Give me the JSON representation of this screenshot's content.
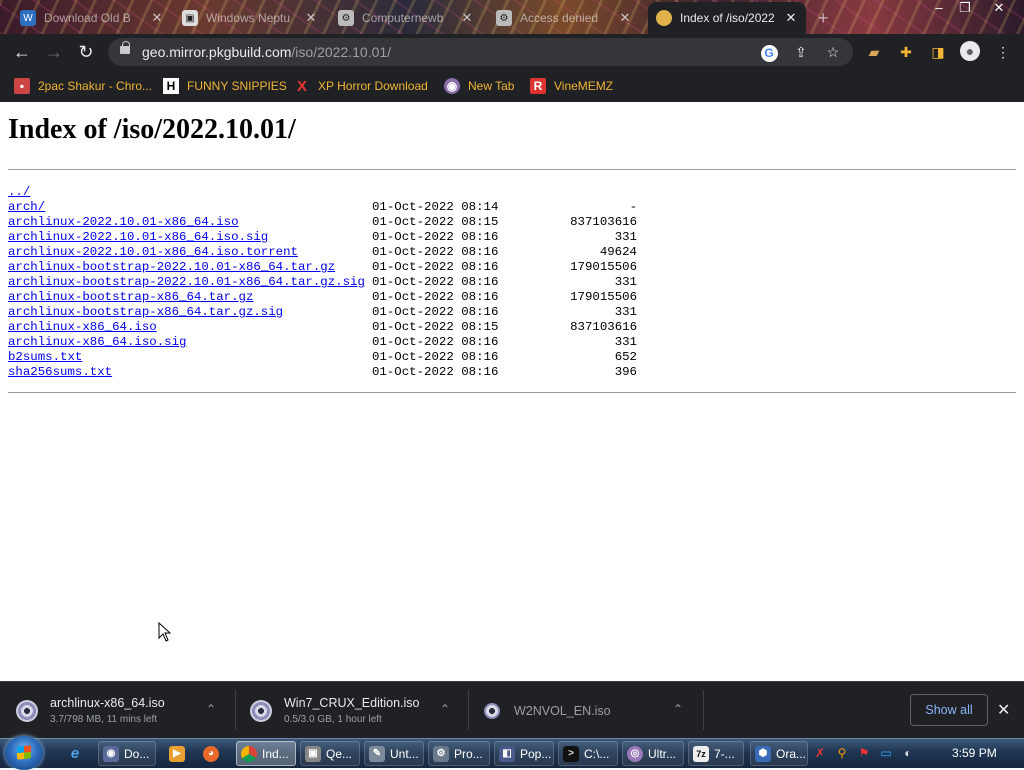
{
  "browser": {
    "tabs": [
      {
        "title": "Download Old B",
        "active": false
      },
      {
        "title": "Windows Neptu",
        "active": false
      },
      {
        "title": "Computernewb",
        "active": false
      },
      {
        "title": "Access denied",
        "active": false
      },
      {
        "title": "Index of /iso/2022",
        "active": true
      }
    ],
    "url_host": "geo.mirror.pkgbuild.com",
    "url_path": "/iso/2022.10.01/",
    "bookmarks": [
      {
        "label": "2pac Shakur - Chro...",
        "icon": "tupac-favicon"
      },
      {
        "label": "FUNNY SNIPPIES",
        "icon": "h-favicon"
      },
      {
        "label": "XP Horror Download",
        "icon": "red-x-favicon"
      },
      {
        "label": "New Tab",
        "icon": "globe-favicon"
      },
      {
        "label": "VineMEMZ",
        "icon": "r-favicon"
      }
    ]
  },
  "page": {
    "heading": "Index of /iso/2022.10.01/",
    "entries": [
      {
        "name": "../",
        "date": "",
        "size": ""
      },
      {
        "name": "arch/",
        "date": "01-Oct-2022 08:14",
        "size": "-"
      },
      {
        "name": "archlinux-2022.10.01-x86_64.iso",
        "date": "01-Oct-2022 08:15",
        "size": "837103616"
      },
      {
        "name": "archlinux-2022.10.01-x86_64.iso.sig",
        "date": "01-Oct-2022 08:16",
        "size": "331"
      },
      {
        "name": "archlinux-2022.10.01-x86_64.iso.torrent",
        "date": "01-Oct-2022 08:16",
        "size": "49624"
      },
      {
        "name": "archlinux-bootstrap-2022.10.01-x86_64.tar.gz",
        "date": "01-Oct-2022 08:16",
        "size": "179015506"
      },
      {
        "name": "archlinux-bootstrap-2022.10.01-x86_64.tar.gz.sig",
        "date": "01-Oct-2022 08:16",
        "size": "331"
      },
      {
        "name": "archlinux-bootstrap-x86_64.tar.gz",
        "date": "01-Oct-2022 08:16",
        "size": "179015506"
      },
      {
        "name": "archlinux-bootstrap-x86_64.tar.gz.sig",
        "date": "01-Oct-2022 08:16",
        "size": "331"
      },
      {
        "name": "archlinux-x86_64.iso",
        "date": "01-Oct-2022 08:15",
        "size": "837103616"
      },
      {
        "name": "archlinux-x86_64.iso.sig",
        "date": "01-Oct-2022 08:16",
        "size": "331"
      },
      {
        "name": "b2sums.txt",
        "date": "01-Oct-2022 08:16",
        "size": "652"
      },
      {
        "name": "sha256sums.txt",
        "date": "01-Oct-2022 08:16",
        "size": "396"
      }
    ]
  },
  "downloads": {
    "items": [
      {
        "name": "archlinux-x86_64.iso",
        "status": "3.7/798 MB, 11 mins left"
      },
      {
        "name": "Win7_CRUX_Edition.iso",
        "status": "0.5/3.0 GB, 1 hour left"
      },
      {
        "name": "W2NVOL_EN.iso",
        "status": ""
      }
    ],
    "show_all": "Show all"
  },
  "taskbar": {
    "items": [
      {
        "label": "Do..."
      },
      {
        "label": "Ind..."
      },
      {
        "label": "Qe..."
      },
      {
        "label": "Unt..."
      },
      {
        "label": "Pro..."
      },
      {
        "label": "Pop..."
      },
      {
        "label": "C:\\..."
      },
      {
        "label": "Ultr..."
      },
      {
        "label": "7-..."
      },
      {
        "label": "Ora..."
      }
    ],
    "clock": "3:59 PM"
  },
  "colors": {
    "link": "#0000ee",
    "chrome_dark": "#202124",
    "bookmark_text": "#f2b534",
    "show_all_text": "#8ab4f8"
  }
}
